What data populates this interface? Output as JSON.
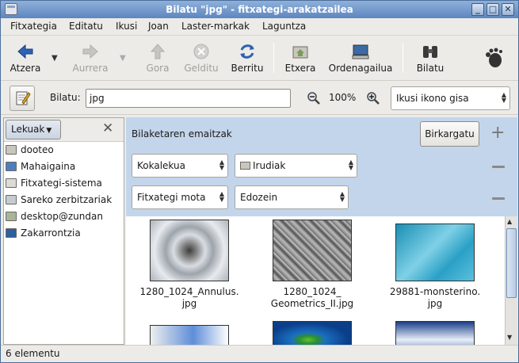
{
  "window": {
    "title": "Bilatu \"jpg\" - fitxategi-arakatzailea"
  },
  "menubar": [
    "Fitxategia",
    "Editatu",
    "Ikusi",
    "Joan",
    "Laster-markak",
    "Laguntza"
  ],
  "toolbar": {
    "back": "Atzera",
    "forward": "Aurrera",
    "up": "Gora",
    "stop": "Gelditu",
    "reload": "Berritu",
    "home": "Etxera",
    "computer": "Ordenagailua",
    "search": "Bilatu"
  },
  "location": {
    "label": "Bilatu:",
    "value": "jpg",
    "zoom": "100%",
    "view_mode": "Ikusi ikono gisa"
  },
  "sidebar": {
    "selector": "Lekuak",
    "places": [
      "dooteo",
      "Mahaigaina",
      "Fitxategi-sistema",
      "Sareko zerbitzariak",
      "desktop@zundan",
      "Zakarrontzia"
    ]
  },
  "search_results": {
    "title": "Bilaketaren emaitzak",
    "reload_button": "Birkargatu",
    "row1": {
      "type": "Kokalekua",
      "value": "Irudiak"
    },
    "row2": {
      "type": "Fitxategi mota",
      "value": "Edozein"
    }
  },
  "files": [
    {
      "name_line1": "1280_1024_Annulus.",
      "name_line2": "jpg"
    },
    {
      "name_line1": "1280_1024_",
      "name_line2": "Geometrics_II.jpg"
    },
    {
      "name_line1": "29881-monsterino.",
      "name_line2": "jpg"
    }
  ],
  "status": "6 elementu",
  "colors": {
    "titlebar": "#6b92c8",
    "results_panel": "#c3d5eb"
  }
}
